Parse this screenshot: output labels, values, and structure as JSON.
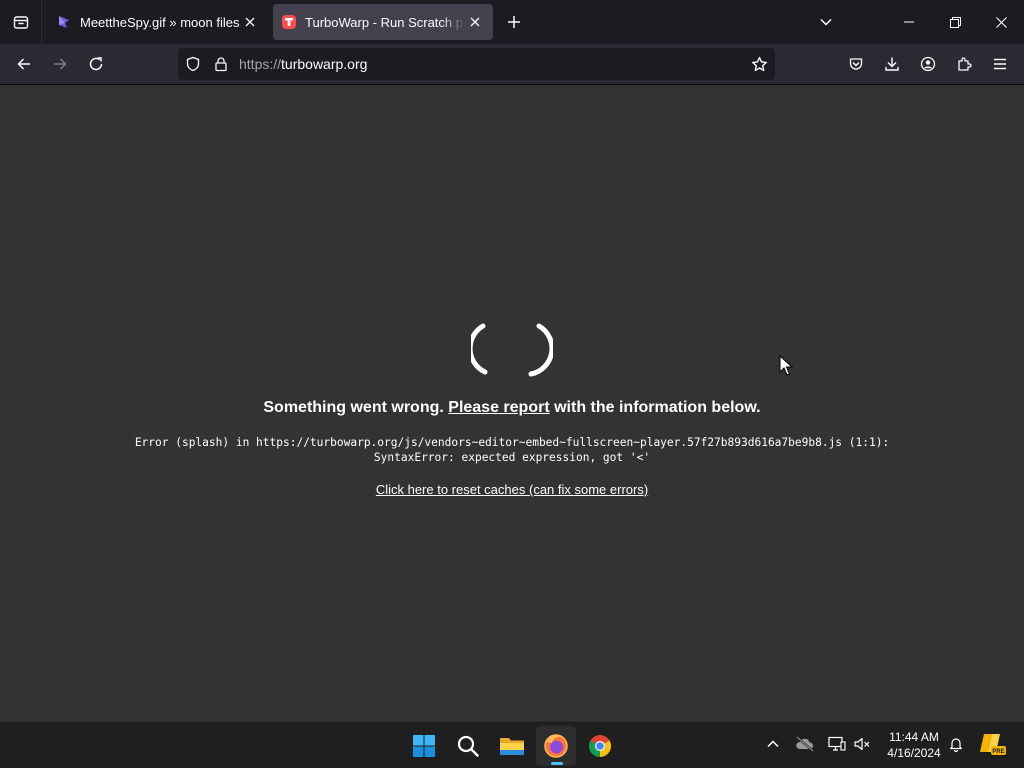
{
  "browser": {
    "tabs": [
      {
        "title": "MeettheSpy.gif » moon files",
        "active": false
      },
      {
        "title": "TurboWarp - Run Scratch projects",
        "active": true
      }
    ],
    "url": {
      "protocol": "https://",
      "host": "turbowarp.org"
    }
  },
  "page": {
    "error_prefix": "Something went wrong. ",
    "error_link": "Please report",
    "error_suffix": " with the information below.",
    "error_line1": "Error (splash) in https://turbowarp.org/js/vendors~editor~embed~fullscreen~player.57f27b893d616a7be9b8.js (1:1):",
    "error_line2": "SyntaxError: expected expression, got '<'",
    "reset_link": "Click here to reset caches (can fix some errors)"
  },
  "taskbar": {
    "apps": [
      "start",
      "search",
      "file-explorer",
      "firefox",
      "chrome"
    ],
    "active_app": "firefox",
    "clock": {
      "time": "11:44 AM",
      "date": "4/16/2024"
    },
    "tray_badge": "PRE"
  },
  "colors": {
    "page_background": "#333333",
    "tabstrip": "#1c1b22",
    "navbar": "#2b2a33",
    "active_tab": "#42414d",
    "taskbar": "#1f1f1f",
    "accent": "#4cc2ff"
  }
}
